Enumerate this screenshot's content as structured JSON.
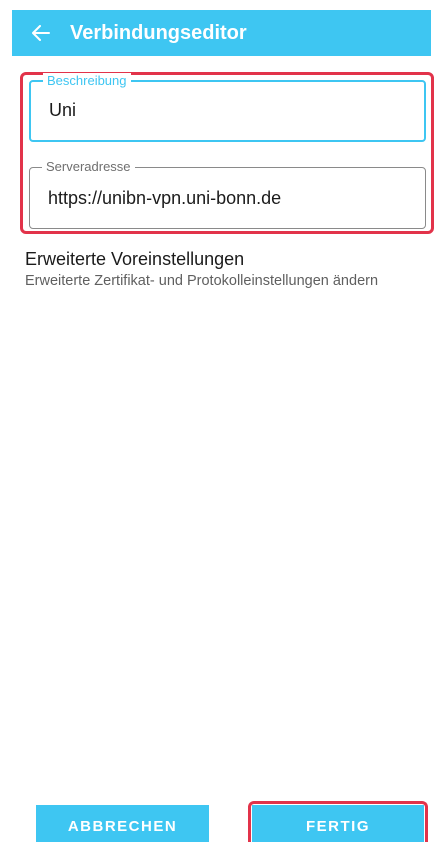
{
  "appbar": {
    "title": "Verbindungseditor",
    "icon": "arrow-left-icon",
    "color": "#3ec6f2"
  },
  "fields": {
    "description": {
      "label": "Beschreibung",
      "value": "Uni"
    },
    "server": {
      "label": "Serveradresse",
      "value": "https://unibn-vpn.uni-bonn.de"
    }
  },
  "advanced": {
    "title": "Erweiterte Voreinstellungen",
    "subtitle": "Erweiterte Zertifikat- und Protokolleinstellungen ändern"
  },
  "buttons": {
    "cancel": "ABBRECHEN",
    "done": "FERTIG"
  },
  "colors": {
    "accent": "#3ec6f2",
    "highlight": "#e2334a"
  }
}
